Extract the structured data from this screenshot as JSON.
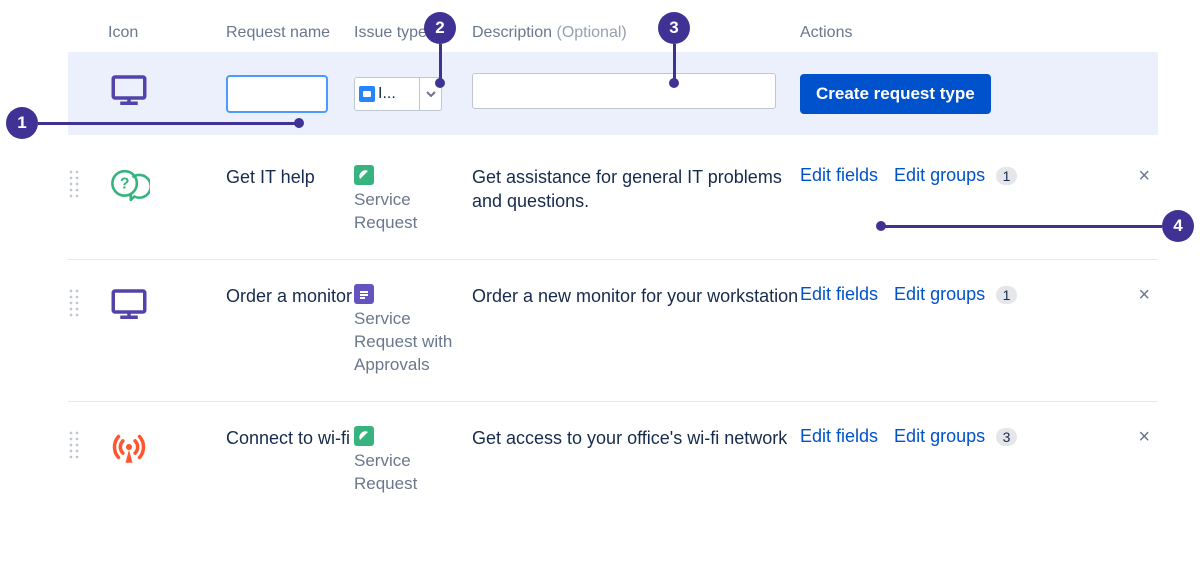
{
  "headers": {
    "icon": "Icon",
    "name": "Request name",
    "type": "Issue type",
    "desc": "Description",
    "desc_optional": "(Optional)",
    "actions": "Actions"
  },
  "create": {
    "type_placeholder": "I...",
    "button": "Create request type"
  },
  "rows": [
    {
      "name": "Get IT help",
      "type": "Service Request",
      "type_glyph": "green",
      "desc": "Get assistance for general IT problems and questions.",
      "edit_fields": "Edit fields",
      "edit_groups": "Edit groups",
      "groups_count": "1",
      "icon": "help"
    },
    {
      "name": "Order a monitor",
      "type": "Service Request with Approvals",
      "type_glyph": "purple",
      "desc": "Order a new monitor for your workstation",
      "edit_fields": "Edit fields",
      "edit_groups": "Edit groups",
      "groups_count": "1",
      "icon": "monitor"
    },
    {
      "name": "Connect to wi-fi",
      "type": "Service Request",
      "type_glyph": "green",
      "desc": "Get access to your office's wi-fi network",
      "edit_fields": "Edit fields",
      "edit_groups": "Edit groups",
      "groups_count": "3",
      "icon": "wifi"
    }
  ],
  "callouts": {
    "c1": "1",
    "c2": "2",
    "c3": "3",
    "c4": "4"
  }
}
